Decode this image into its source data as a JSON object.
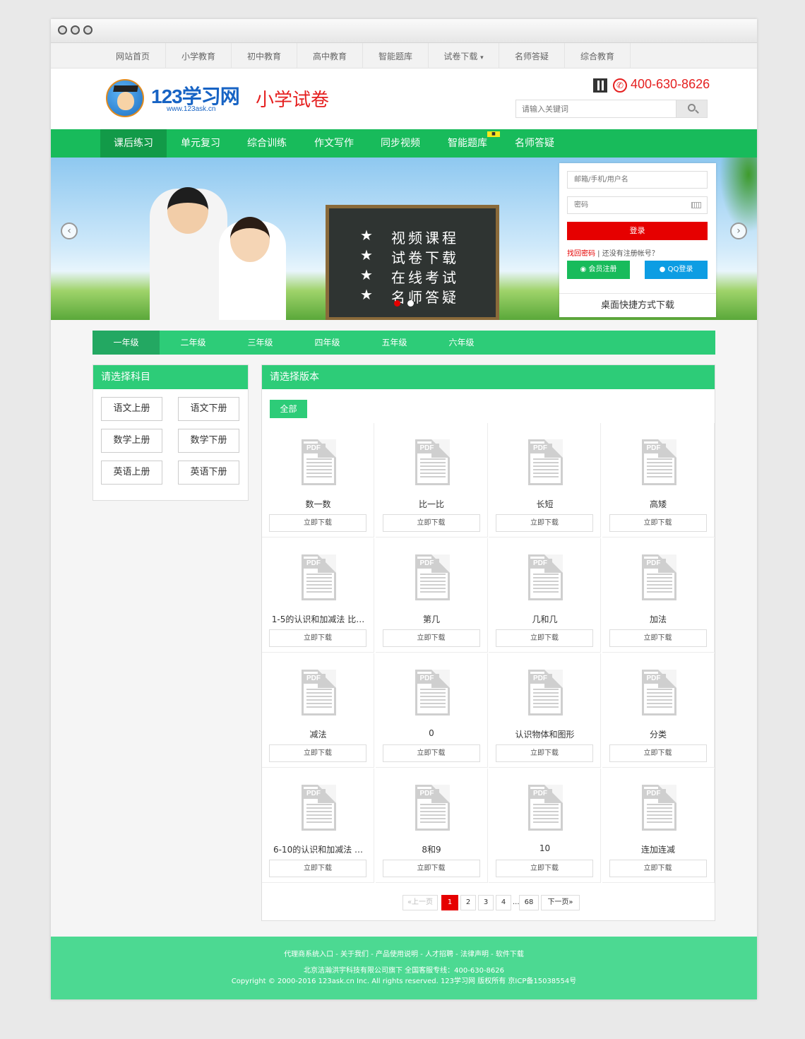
{
  "top_nav": [
    "网站首页",
    "小学教育",
    "初中教育",
    "高中教育",
    "智能题库",
    "试卷下载",
    "名师答疑",
    "综合教育"
  ],
  "top_nav_dropdown_marker": "▾",
  "logo": {
    "text": "123学习网",
    "url": "www.123ask.cn"
  },
  "site_title": "小学试卷",
  "hotline": "400-630-8626",
  "search": {
    "placeholder": "请输入关键词"
  },
  "main_nav": [
    "课后练习",
    "单元复习",
    "综合训练",
    "作文写作",
    "同步视频",
    "智能题库",
    "名师答疑"
  ],
  "main_nav_active": "课后练习",
  "banner": {
    "lines": [
      "视频课程",
      "试卷下载",
      "在线考试",
      "名师答疑"
    ],
    "star": "★",
    "prev": "‹",
    "next": "›"
  },
  "login": {
    "user_placeholder": "邮箱/手机/用户名",
    "password_placeholder": "密码",
    "login_button": "登录",
    "forgot": "找回密码",
    "no_account": "还没有注册帐号？",
    "register_button": "会员注册",
    "qq_button": "QQ登录",
    "desktop_download": "桌面快捷方式下载"
  },
  "grades": [
    "一年级",
    "二年级",
    "三年级",
    "四年级",
    "五年级",
    "六年级"
  ],
  "subject_panel": {
    "title": "请选择科目",
    "subjects": [
      "语文上册",
      "语文下册",
      "数学上册",
      "数学下册",
      "英语上册",
      "英语下册"
    ]
  },
  "version_panel": {
    "title": "请选择版本",
    "all_button": "全部"
  },
  "pdf_label": "PDF",
  "download_label": "立即下载",
  "papers": [
    "数一数",
    "比一比",
    "长短",
    "高矮",
    "1-5的认识和加减法 比…",
    "第几",
    "几和几",
    "加法",
    "减法",
    "0",
    "认识物体和图形",
    "分类",
    "6-10的认识和加减法 …",
    "8和9",
    "10",
    "连加连减"
  ],
  "pagination": {
    "prev": "«上一页",
    "pages": [
      "1",
      "2",
      "3",
      "4"
    ],
    "ellipsis": "...",
    "last": "68",
    "next": "下一页»"
  },
  "footer": {
    "links": "代理商系统入口 - 关于我们 - 产品使用说明 - 人才招聘 - 法律声明 - 软件下载",
    "company": "北京洁瀚洪宇科技有限公司旗下 全国客服专线：400-630-8626",
    "copyright": "Copyright © 2000-2016 123ask.cn Inc. All rights reserved. 123学习网 版权所有 京ICP备15038554号"
  },
  "colors": {
    "green": "#18bb5b",
    "light_green": "#2dcc78",
    "red": "#e60000",
    "blue": "#0d9de3",
    "footer": "#4cd992"
  }
}
